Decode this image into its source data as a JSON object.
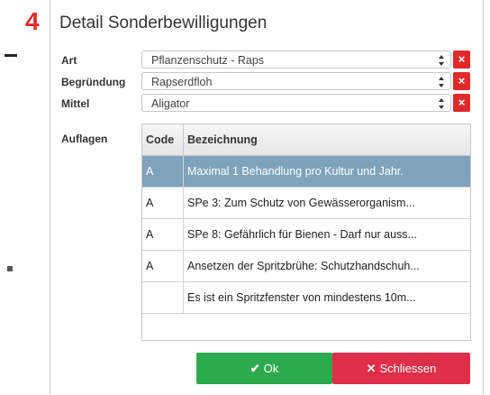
{
  "step_number": "4",
  "dialog": {
    "title": "Detail Sonderbewilligungen",
    "fields": {
      "art": {
        "label": "Art",
        "value": "Pflanzenschutz - Raps"
      },
      "begruendung": {
        "label": "Begründung",
        "value": "Rapserdfloh"
      },
      "mittel": {
        "label": "Mittel",
        "value": "Aligator"
      }
    },
    "clear_glyph": "×",
    "auflagen": {
      "label": "Auflagen",
      "columns": {
        "code": "Code",
        "bezeichnung": "Bezeichnung"
      },
      "rows": [
        {
          "code": "A",
          "bezeichnung": "Maximal 1 Behandlung pro Kultur und Jahr."
        },
        {
          "code": "A",
          "bezeichnung": "SPe 3: Zum Schutz von Gewässerorganism..."
        },
        {
          "code": "A",
          "bezeichnung": "SPe 8: Gefährlich für Bienen - Darf nur auss..."
        },
        {
          "code": "A",
          "bezeichnung": "Ansetzen der Spritzbrühe: Schutzhandschuh..."
        },
        {
          "code": "",
          "bezeichnung": "Es ist ein Spritzfenster von mindestens 10m..."
        }
      ],
      "selected_index": 0
    },
    "buttons": {
      "ok": {
        "icon": "✔",
        "label": "Ok"
      },
      "close": {
        "icon": "✕",
        "label": "Schliessen"
      }
    }
  },
  "colors": {
    "accent_red": "#e02a2a",
    "ok_green": "#2daa4e",
    "close_red": "#df2f48",
    "selected_row": "#7ea3bb"
  }
}
